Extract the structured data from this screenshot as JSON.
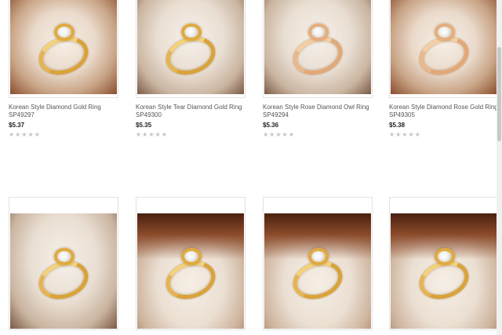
{
  "products": [
    {
      "title": "Korean Style Diamond Gold Ring SP49297",
      "price": "$5.37",
      "rating": 0,
      "stars": [
        "★",
        "★",
        "★",
        "★",
        "★"
      ],
      "metal": "gold"
    },
    {
      "title": "Korean Style Tear Diamond Gold Ring SP49300",
      "price": "$5.35",
      "rating": 0,
      "stars": [
        "★",
        "★",
        "★",
        "★",
        "★"
      ],
      "metal": "gold"
    },
    {
      "title": "Korean Style Rose Diamond Owl Ring SP49294",
      "price": "$5.36",
      "rating": 0,
      "stars": [
        "★",
        "★",
        "★",
        "★",
        "★"
      ],
      "metal": "rose"
    },
    {
      "title": "Korean Style Diamond Rose Gold Ring SP49305",
      "price": "$5.38",
      "rating": 0,
      "stars": [
        "★",
        "★",
        "★",
        "★",
        "★"
      ],
      "metal": "rose"
    },
    {
      "title": "",
      "price": "",
      "metal": "gold"
    },
    {
      "title": "",
      "price": "",
      "metal": "gold"
    },
    {
      "title": "",
      "price": "",
      "metal": "gold"
    },
    {
      "title": "",
      "price": "",
      "metal": "gold"
    }
  ],
  "colors": {
    "title_text": "#555555",
    "price_text": "#222222",
    "star_empty": "#c4c4c4",
    "card_border": "#e3e3e3",
    "gold": "#d9a33a",
    "rose_gold": "#e2a877"
  },
  "icons": {
    "rating": "star-icon"
  }
}
